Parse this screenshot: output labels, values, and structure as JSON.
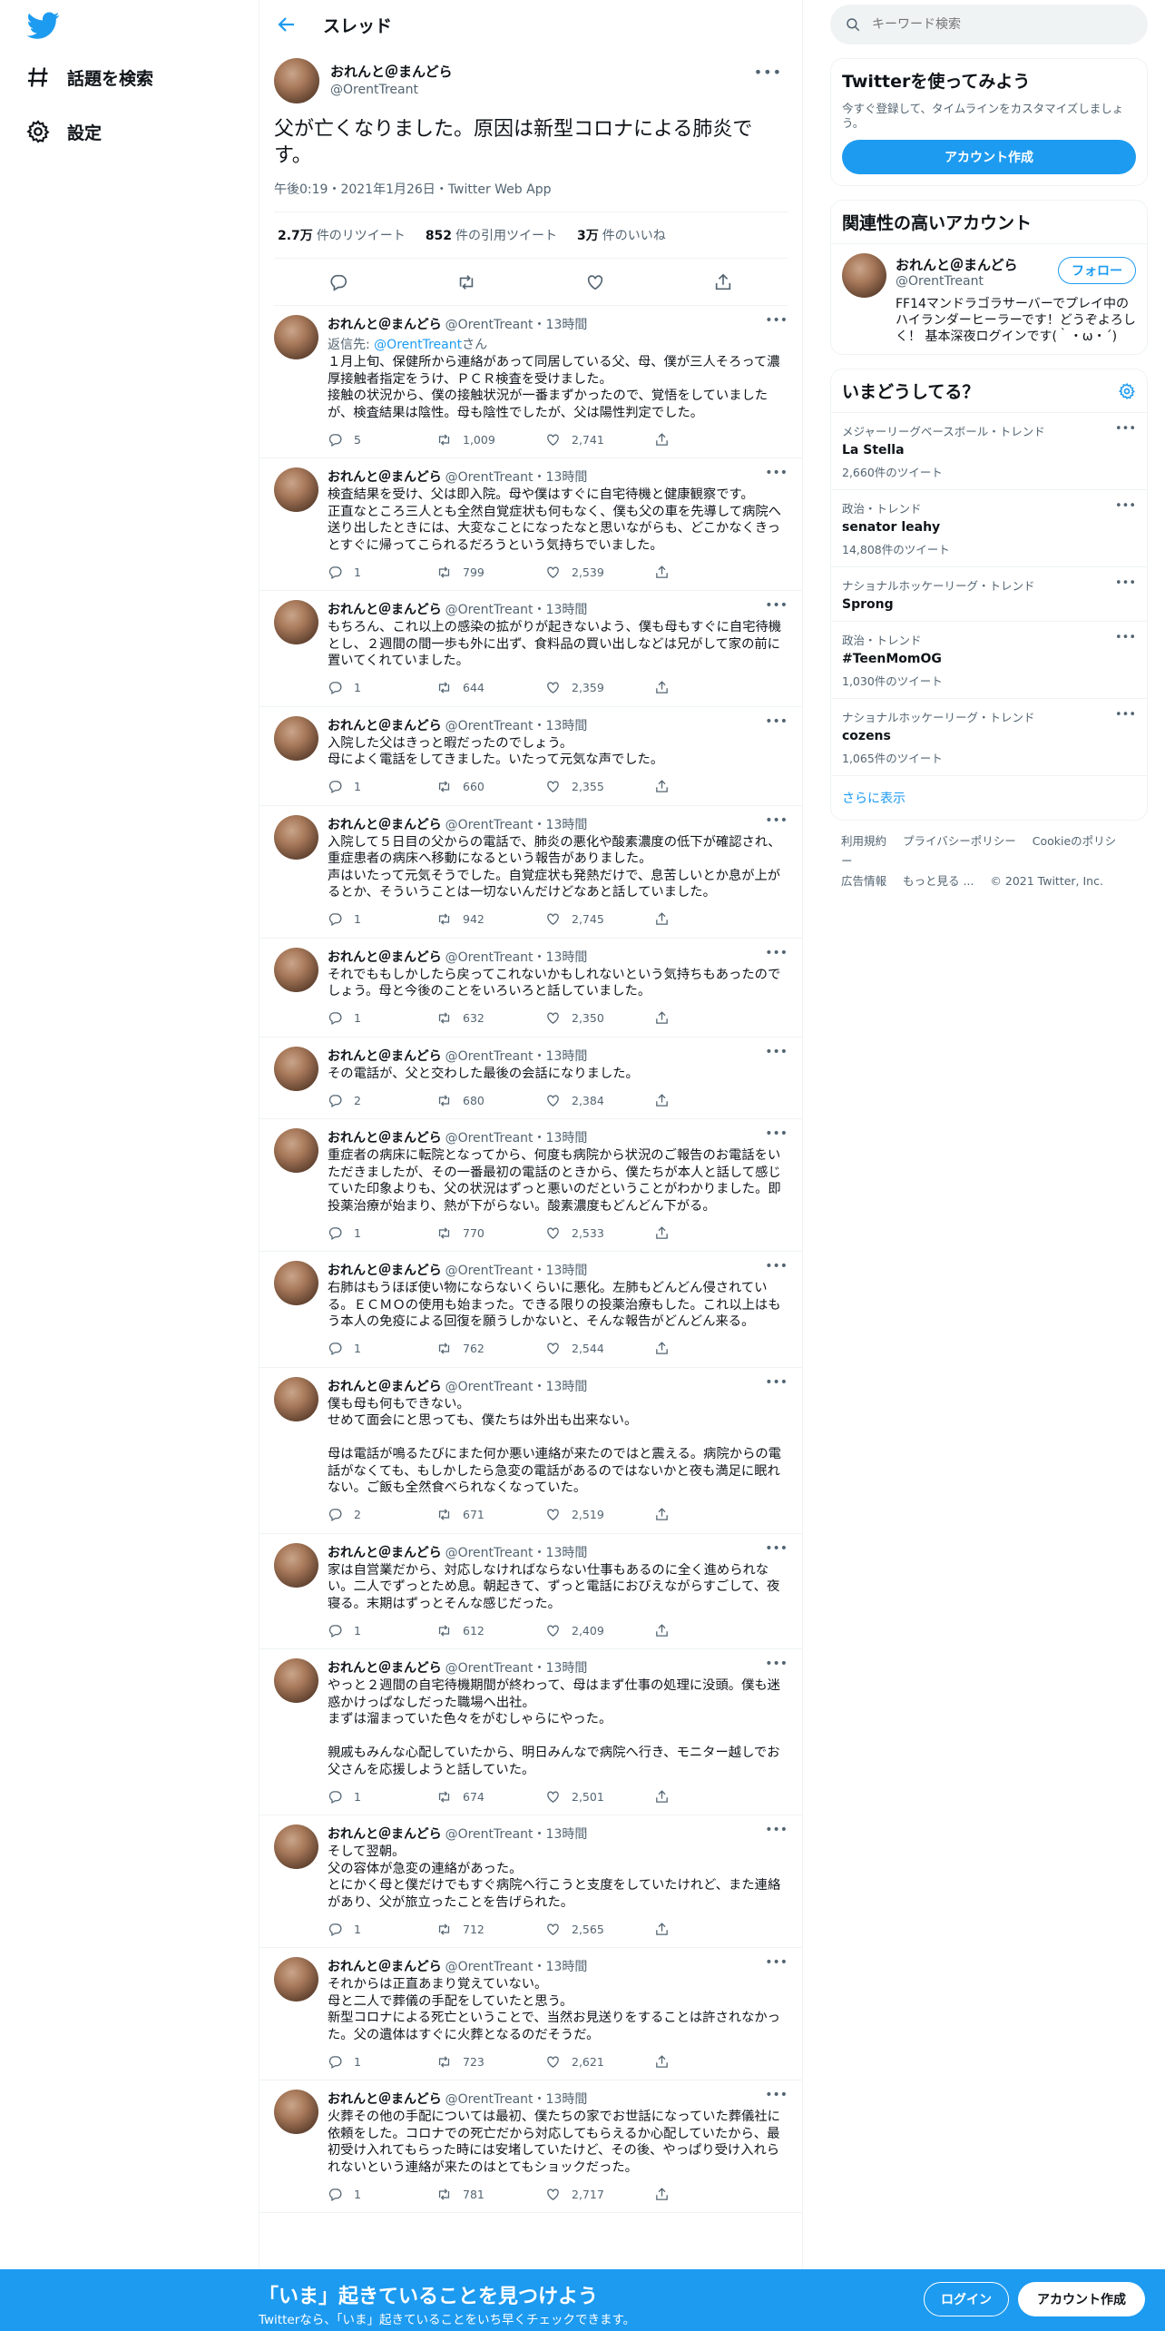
{
  "nav": {
    "logo": "twitter-bird-icon",
    "items": [
      {
        "label": "話題を検索",
        "icon": "hashtag-icon"
      },
      {
        "label": "設定",
        "icon": "gear-icon"
      }
    ]
  },
  "header": {
    "title": "スレッド"
  },
  "main_tweet": {
    "name": "おれんと＠まんどら",
    "handle": "@OrentTreant",
    "text": "父が亡くなりました。原因は新型コロナによる肺炎です。",
    "time": "午後0:19・2021年1月26日・Twitter Web App",
    "retweets_num": "2.7万",
    "retweets_label": "件のリツイート",
    "quotes_num": "852",
    "quotes_label": "件の引用ツイート",
    "likes_num": "3万",
    "likes_label": "件のいいね"
  },
  "replies": [
    {
      "name": "おれんと＠まんどら",
      "handle": "@OrentTreant・13時間",
      "reply_to_prefix": "返信先: ",
      "reply_to_handle": "@OrentTreant",
      "reply_to_suffix": "さん",
      "text": "１月上旬、保健所から連絡があって同居している父、母、僕が三人そろって濃厚接触者指定をうけ、ＰＣＲ検査を受けました。\n接触の状況から、僕の接触状況が一番まずかったので、覚悟をしていましたが、検査結果は陰性。母も陰性でしたが、父は陽性判定でした。",
      "replies": "5",
      "retweets": "1,009",
      "likes": "2,741"
    },
    {
      "name": "おれんと＠まんどら",
      "handle": "@OrentTreant・13時間",
      "text": "検査結果を受け、父は即入院。母や僕はすぐに自宅待機と健康観察です。\n正直なところ三人とも全然自覚症状も何もなく、僕も父の車を先導して病院へ送り出したときには、大変なことになったなと思いながらも、どこかなくきっとすぐに帰ってこられるだろうという気持ちでいました。",
      "replies": "1",
      "retweets": "799",
      "likes": "2,539"
    },
    {
      "name": "おれんと＠まんどら",
      "handle": "@OrentTreant・13時間",
      "text": "もちろん、これ以上の感染の拡がりが起きないよう、僕も母もすぐに自宅待機とし、２週間の間一歩も外に出ず、食料品の買い出しなどは兄がして家の前に置いてくれていました。",
      "replies": "1",
      "retweets": "644",
      "likes": "2,359"
    },
    {
      "name": "おれんと＠まんどら",
      "handle": "@OrentTreant・13時間",
      "text": "入院した父はきっと暇だったのでしょう。\n母によく電話をしてきました。いたって元気な声でした。",
      "replies": "1",
      "retweets": "660",
      "likes": "2,355"
    },
    {
      "name": "おれんと＠まんどら",
      "handle": "@OrentTreant・13時間",
      "text": "入院して５日目の父からの電話で、肺炎の悪化や酸素濃度の低下が確認され、重症患者の病床へ移動になるという報告がありました。\n声はいたって元気そうでした。自覚症状も発熱だけで、息苦しいとか息が上がるとか、そういうことは一切ないんだけどなあと話していました。",
      "replies": "1",
      "retweets": "942",
      "likes": "2,745"
    },
    {
      "name": "おれんと＠まんどら",
      "handle": "@OrentTreant・13時間",
      "text": "それでももしかしたら戻ってこれないかもしれないという気持ちもあったのでしょう。母と今後のことをいろいろと話していました。",
      "replies": "1",
      "retweets": "632",
      "likes": "2,350"
    },
    {
      "name": "おれんと＠まんどら",
      "handle": "@OrentTreant・13時間",
      "text": "その電話が、父と交わした最後の会話になりました。",
      "replies": "2",
      "retweets": "680",
      "likes": "2,384"
    },
    {
      "name": "おれんと＠まんどら",
      "handle": "@OrentTreant・13時間",
      "text": "重症者の病床に転院となってから、何度も病院から状況のご報告のお電話をいただきましたが、その一番最初の電話のときから、僕たちが本人と話して感じていた印象よりも、父の状況はずっと悪いのだということがわかりました。即投薬治療が始まり、熱が下がらない。酸素濃度もどんどん下がる。",
      "replies": "1",
      "retweets": "770",
      "likes": "2,533"
    },
    {
      "name": "おれんと＠まんどら",
      "handle": "@OrentTreant・13時間",
      "text": "右肺はもうほぼ使い物にならないくらいに悪化。左肺もどんどん侵されている。ＥＣＭＯの使用も始まった。できる限りの投薬治療もした。これ以上はもう本人の免疫による回復を願うしかないと、そんな報告がどんどん来る。",
      "replies": "1",
      "retweets": "762",
      "likes": "2,544"
    },
    {
      "name": "おれんと＠まんどら",
      "handle": "@OrentTreant・13時間",
      "text": "僕も母も何もできない。\nせめて面会にと思っても、僕たちは外出も出来ない。\n\n母は電話が鳴るたびにまた何か悪い連絡が来たのではと震える。病院からの電話がなくても、もしかしたら急変の電話があるのではないかと夜も満足に眠れない。ご飯も全然食べられなくなっていた。",
      "replies": "2",
      "retweets": "671",
      "likes": "2,519"
    },
    {
      "name": "おれんと＠まんどら",
      "handle": "@OrentTreant・13時間",
      "text": "家は自営業だから、対応しなければならない仕事もあるのに全く進められない。二人でずっとため息。朝起きて、ずっと電話におびえながらすごして、夜寝る。末期はずっとそんな感じだった。",
      "replies": "1",
      "retweets": "612",
      "likes": "2,409"
    },
    {
      "name": "おれんと＠まんどら",
      "handle": "@OrentTreant・13時間",
      "text": "やっと２週間の自宅待機期間が終わって、母はまず仕事の処理に没頭。僕も迷惑かけっぱなしだった職場へ出社。\nまずは溜まっていた色々をがむしゃらにやった。\n\n親戚もみんな心配していたから、明日みんなで病院へ行き、モニター越しでお父さんを応援しようと話していた。",
      "replies": "1",
      "retweets": "674",
      "likes": "2,501"
    },
    {
      "name": "おれんと＠まんどら",
      "handle": "@OrentTreant・13時間",
      "text": "そして翌朝。\n父の容体が急変の連絡があった。\nとにかく母と僕だけでもすぐ病院へ行こうと支度をしていたけれど、また連絡があり、父が旅立ったことを告げられた。",
      "replies": "1",
      "retweets": "712",
      "likes": "2,565"
    },
    {
      "name": "おれんと＠まんどら",
      "handle": "@OrentTreant・13時間",
      "text": "それからは正直あまり覚えていない。\n母と二人で葬儀の手配をしていたと思う。\n新型コロナによる死亡ということで、当然お見送りをすることは許されなかった。父の遺体はすぐに火葬となるのだそうだ。",
      "replies": "1",
      "retweets": "723",
      "likes": "2,621"
    },
    {
      "name": "おれんと＠まんどら",
      "handle": "@OrentTreant・13時間",
      "text": "火葬その他の手配については最初、僕たちの家でお世話になっていた葬儀社に依頼をした。コロナでの死亡だから対応してもらえるか心配していたから、最初受け入れてもらった時には安堵していたけど、その後、やっぱり受け入れられないという連絡が来たのはとてもショックだった。",
      "replies": "1",
      "retweets": "781",
      "likes": "2,717"
    }
  ],
  "search": {
    "placeholder": "キーワード検索"
  },
  "try_box": {
    "title": "Twitterを使ってみよう",
    "desc": "今すぐ登録して、タイムラインをカスタマイズしましょう。",
    "button": "アカウント作成"
  },
  "related": {
    "title": "関連性の高いアカウント",
    "name": "おれんと＠まんどら",
    "handle": "@OrentTreant",
    "follow": "フォロー",
    "bio": "FF14マンドラゴラサーバーでプレイ中のハイランダーヒーラーです！どうぞよろしく！ 基本深夜ログインです(｀・ω・´)"
  },
  "trends": {
    "title": "いまどうしてる？",
    "items": [
      {
        "category": "メジャーリーグベースボール・トレンド",
        "name": "La Stella",
        "count": "2,660件のツイート"
      },
      {
        "category": "政治・トレンド",
        "name": "senator leahy",
        "count": "14,808件のツイート"
      },
      {
        "category": "ナショナルホッケーリーグ・トレンド",
        "name": "Sprong",
        "count": ""
      },
      {
        "category": "政治・トレンド",
        "name": "#TeenMomOG",
        "count": "1,030件のツイート"
      },
      {
        "category": "ナショナルホッケーリーグ・トレンド",
        "name": "cozens",
        "count": "1,065件のツイート"
      }
    ],
    "more": "さらに表示"
  },
  "footer": {
    "terms": "利用規約",
    "privacy": "プライバシーポリシー",
    "cookie": "Cookieのポリシー",
    "ads": "広告情報",
    "more": "もっと見る ...",
    "copyright": "© 2021 Twitter, Inc."
  },
  "bottom_bar": {
    "title": "「いま」起きていることを見つけよう",
    "subtitle": "Twitterなら、「いま」起きていることをいち早くチェックできます。",
    "login": "ログイン",
    "signup": "アカウント作成"
  },
  "colors": {
    "accent": "#1d9bf0",
    "text": "#0f1419",
    "muted": "#536471"
  }
}
